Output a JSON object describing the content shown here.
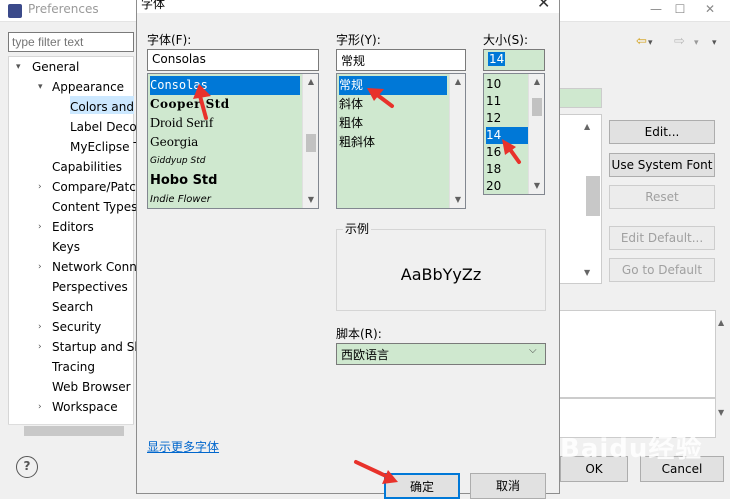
{
  "preferences": {
    "title": "Preferences",
    "filter_placeholder": "type filter text",
    "tree": [
      {
        "label": "General",
        "arrow": "▾"
      },
      {
        "label": "Appearance",
        "arrow": "▾"
      },
      {
        "label": "Colors and",
        "arrow": ""
      },
      {
        "label": "Label Deco",
        "arrow": ""
      },
      {
        "label": "MyEclipse T",
        "arrow": ""
      },
      {
        "label": "Capabilities",
        "arrow": ""
      },
      {
        "label": "Compare/Patc",
        "arrow": "›"
      },
      {
        "label": "Content Types",
        "arrow": ""
      },
      {
        "label": "Editors",
        "arrow": "›"
      },
      {
        "label": "Keys",
        "arrow": ""
      },
      {
        "label": "Network Conn",
        "arrow": "›"
      },
      {
        "label": "Perspectives",
        "arrow": ""
      },
      {
        "label": "Search",
        "arrow": ""
      },
      {
        "label": "Security",
        "arrow": "›"
      },
      {
        "label": "Startup and Sh",
        "arrow": "›"
      },
      {
        "label": "Tracing",
        "arrow": ""
      },
      {
        "label": "Web Browser",
        "arrow": ""
      },
      {
        "label": "Workspace",
        "arrow": "›"
      }
    ],
    "buttons": {
      "edit": "Edit...",
      "use_system_font": "Use System Font",
      "reset": "Reset",
      "edit_default": "Edit Default...",
      "go_to_default": "Go to Default",
      "ok": "OK",
      "cancel": "Cancel"
    },
    "help": "?"
  },
  "font_dialog": {
    "title": "字体",
    "font_label": "字体(F):",
    "font_value": "Consolas",
    "font_list": [
      "Consolas",
      "Cooper Std",
      "Droid Serif",
      "Georgia",
      "Giddyup Std",
      "Hobo Std",
      "Indie Flower"
    ],
    "style_label": "字形(Y):",
    "style_value": "常规",
    "style_list": [
      "常规",
      "斜体",
      "粗体",
      "粗斜体"
    ],
    "size_label": "大小(S):",
    "size_value": "14",
    "size_list": [
      "10",
      "11",
      "12",
      "14",
      "16",
      "18",
      "20"
    ],
    "sample_legend": "示例",
    "sample_text": "AaBbYyZz",
    "script_label": "脚本(R):",
    "script_value": "西欧语言",
    "more_fonts": "显示更多字体",
    "ok": "确定",
    "cancel": "取消"
  },
  "watermark": "Baidu经验",
  "colors": {
    "list_bg": "#cfe8cf",
    "selection": "#0078d7",
    "annotation_arrow": "#e8322b"
  }
}
